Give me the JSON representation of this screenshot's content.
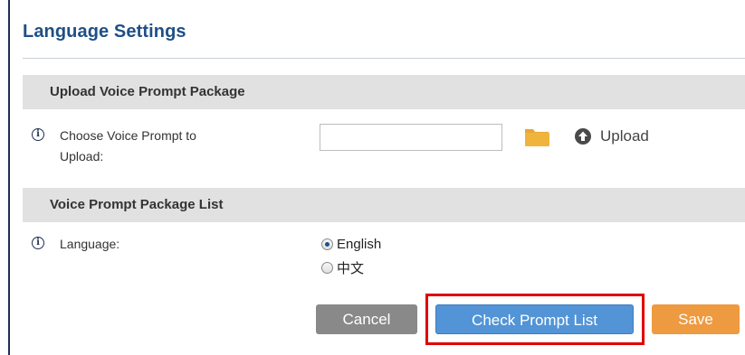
{
  "page": {
    "title": "Language Settings"
  },
  "upload_section": {
    "header": "Upload Voice Prompt Package",
    "field_label_line1": "Choose Voice Prompt to",
    "field_label_line2": "Upload:",
    "file_value": "",
    "upload_label": "Upload"
  },
  "list_section": {
    "header": "Voice Prompt Package List",
    "language_label": "Language:",
    "options": [
      {
        "label": "English",
        "selected": true
      },
      {
        "label": "中文",
        "selected": false
      }
    ]
  },
  "buttons": {
    "cancel": "Cancel",
    "check_prompt_list": "Check Prompt List",
    "save": "Save"
  },
  "colors": {
    "title": "#1f4f86",
    "section_header_bg": "#e1e1e1",
    "cancel": "#898989",
    "primary": "#5294d6",
    "save": "#ee9a40",
    "highlight": "#e00000"
  },
  "icons": {
    "info": "info-circle-icon",
    "folder": "folder-icon",
    "upload": "upload-arrow-icon"
  }
}
